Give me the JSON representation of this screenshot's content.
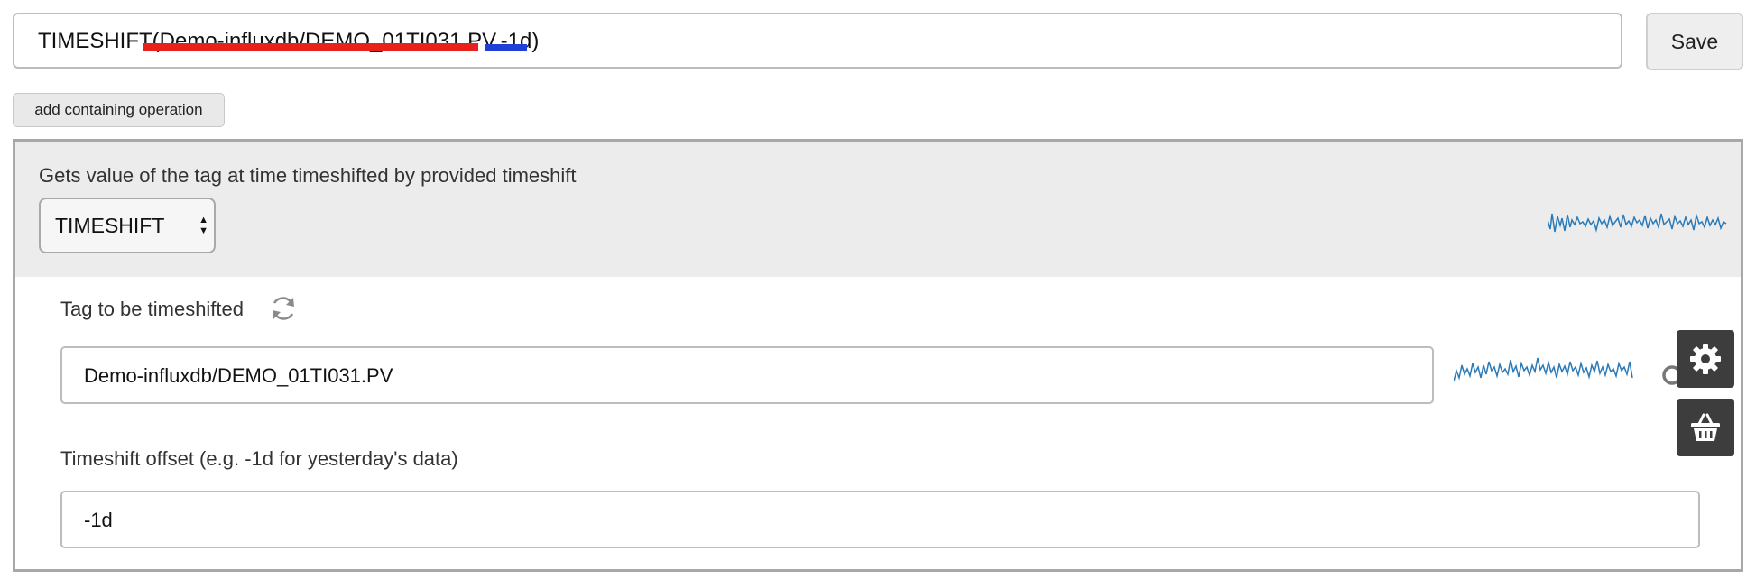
{
  "formula": {
    "prefix": "TIMESHIFT(",
    "tag_arg": "Demo-influxdb/DEMO_01TI031.PV",
    "separator": ",",
    "offset_arg": "-1d",
    "suffix": ")",
    "underline_colors": {
      "tag": "#e8211a",
      "offset": "#1f3fd6"
    }
  },
  "toolbar": {
    "save_label": "Save",
    "add_operation_label": "add containing operation"
  },
  "operation": {
    "description": "Gets value of the tag at time timeshifted by provided timeshift",
    "selected": "TIMESHIFT",
    "params": {
      "tag_label": "Tag to be timeshifted",
      "tag_value": "Demo-influxdb/DEMO_01TI031.PV",
      "offset_label": "Timeshift offset (e.g. -1d for yesterday's data)",
      "offset_value": "-1d"
    }
  },
  "icons": {
    "refresh": "refresh-icon",
    "search": "search-icon",
    "settings": "gear-icon",
    "basket": "basket-icon"
  },
  "colors": {
    "sparkline": "#2a7ab8",
    "panel_header": "#ececec",
    "side_buttons": "#3d3d3d"
  }
}
